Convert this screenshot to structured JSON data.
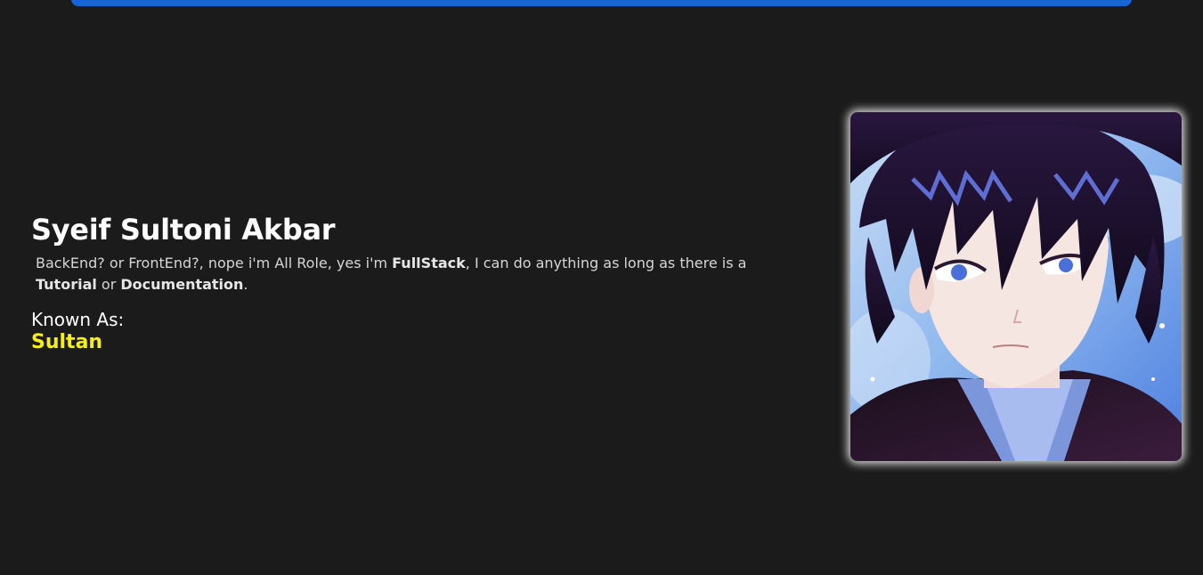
{
  "header": {
    "bar_color": "#1565d8"
  },
  "profile": {
    "name": "Syeif Sultoni Akbar",
    "bio": {
      "part1": "BackEnd? or FrontEnd?, nope i'm All Role, yes i'm ",
      "bold1": "FullStack",
      "part2": ", I can do anything as long as there is a ",
      "bold2": "Tutorial",
      "part3": " or ",
      "bold3": "Documentation",
      "part4": "."
    },
    "known_as_label": "Known As:",
    "known_as_value": "Sultan",
    "accent_color": "#f6ee14"
  },
  "avatar": {
    "icon": "anime-character-avatar"
  }
}
